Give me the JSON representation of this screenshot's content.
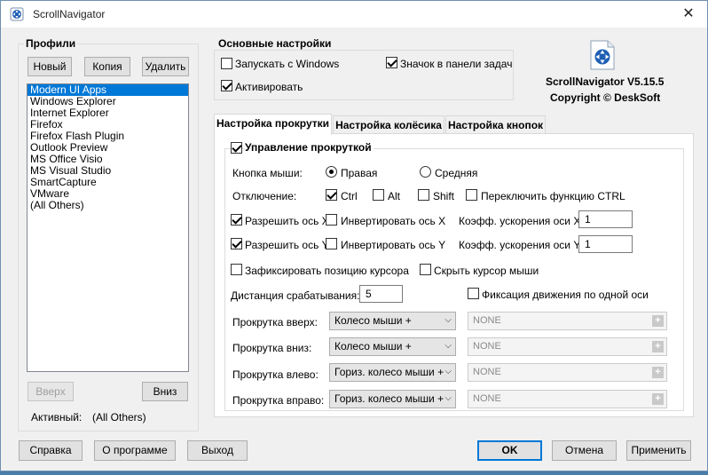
{
  "window": {
    "title": "ScrollNavigator",
    "close_glyph": "✕"
  },
  "profiles": {
    "group_title": "Профили",
    "new_label": "Новый",
    "copy_label": "Копия",
    "delete_label": "Удалить",
    "items": [
      "Modern UI Apps",
      "Windows Explorer",
      "Internet Explorer",
      "Firefox",
      "Firefox Flash Plugin",
      "Outlook Preview",
      "MS Office Visio",
      "MS Visual Studio",
      "SmartCapture",
      "VMware",
      "(All Others)"
    ],
    "selected_index": 0,
    "up_label": "Вверх",
    "down_label": "Вниз",
    "active_label": "Активный:",
    "active_value": "(All Others)"
  },
  "main_settings": {
    "group_title": "Основные настройки",
    "start_with_windows": {
      "label": "Запускать с Windows",
      "checked": false
    },
    "tray_icon": {
      "label": "Значок в панели задач",
      "checked": true
    },
    "activate": {
      "label": "Активировать",
      "checked": true
    }
  },
  "about": {
    "product": "ScrollNavigator V5.15.5",
    "copyright": "Copyright © DeskSoft"
  },
  "tabs": {
    "scroll": "Настройка прокрутки",
    "wheel": "Настройка колёсика",
    "buttons": "Настройка кнопок",
    "active": "scroll"
  },
  "scroll_tab": {
    "control_label": "Управление прокруткой",
    "control_checked": true,
    "mouse_button_label": "Кнопка мыши:",
    "right_label": "Правая",
    "right_checked": true,
    "middle_label": "Средняя",
    "middle_checked": false,
    "disable_label": "Отключение:",
    "ctrl": {
      "label": "Ctrl",
      "checked": true
    },
    "alt": {
      "label": "Alt",
      "checked": false
    },
    "shift": {
      "label": "Shift",
      "checked": false
    },
    "toggle_ctrl": {
      "label": "Переключить функцию CTRL",
      "checked": false
    },
    "allow_x": {
      "label": "Разрешить ось X",
      "checked": true
    },
    "invert_x": {
      "label": "Инвертировать ось X",
      "checked": false
    },
    "accel_x_label": "Коэфф. ускорения оси X",
    "accel_x_value": "1",
    "allow_y": {
      "label": "Разрешить ось Y",
      "checked": true
    },
    "invert_y": {
      "label": "Инвертировать ось Y",
      "checked": false
    },
    "accel_y_label": "Коэфф. ускорения оси Y",
    "accel_y_value": "1",
    "fix_cursor": {
      "label": "Зафиксировать позицию курсора",
      "checked": false
    },
    "hide_cursor": {
      "label": "Скрыть курсор мыши",
      "checked": false
    },
    "distance_label": "Дистанция срабатывания:",
    "distance_value": "5",
    "single_axis": {
      "label": "Фиксация движения по одной оси",
      "checked": false
    },
    "scroll_up_label": "Прокрутка вверх:",
    "scroll_up_value": "Колесо мыши +",
    "scroll_up_mod": "NONE",
    "scroll_down_label": "Прокрутка вниз:",
    "scroll_down_value": "Колесо мыши +",
    "scroll_down_mod": "NONE",
    "scroll_left_label": "Прокрутка влево:",
    "scroll_left_value": "Гориз. колесо мыши +",
    "scroll_left_mod": "NONE",
    "scroll_right_label": "Прокрутка вправо:",
    "scroll_right_value": "Гориз. колесо мыши +",
    "scroll_right_mod": "NONE",
    "plus_glyph": "+",
    "chevron_glyph": "⌵"
  },
  "footer": {
    "help": "Справка",
    "about": "О программе",
    "exit": "Выход",
    "ok": "OK",
    "cancel": "Отмена",
    "apply": "Применить"
  },
  "colors": {
    "selection": "#0078d7",
    "window_bg": "#f0f0f0",
    "icon_blue": "#1f5fb4"
  }
}
